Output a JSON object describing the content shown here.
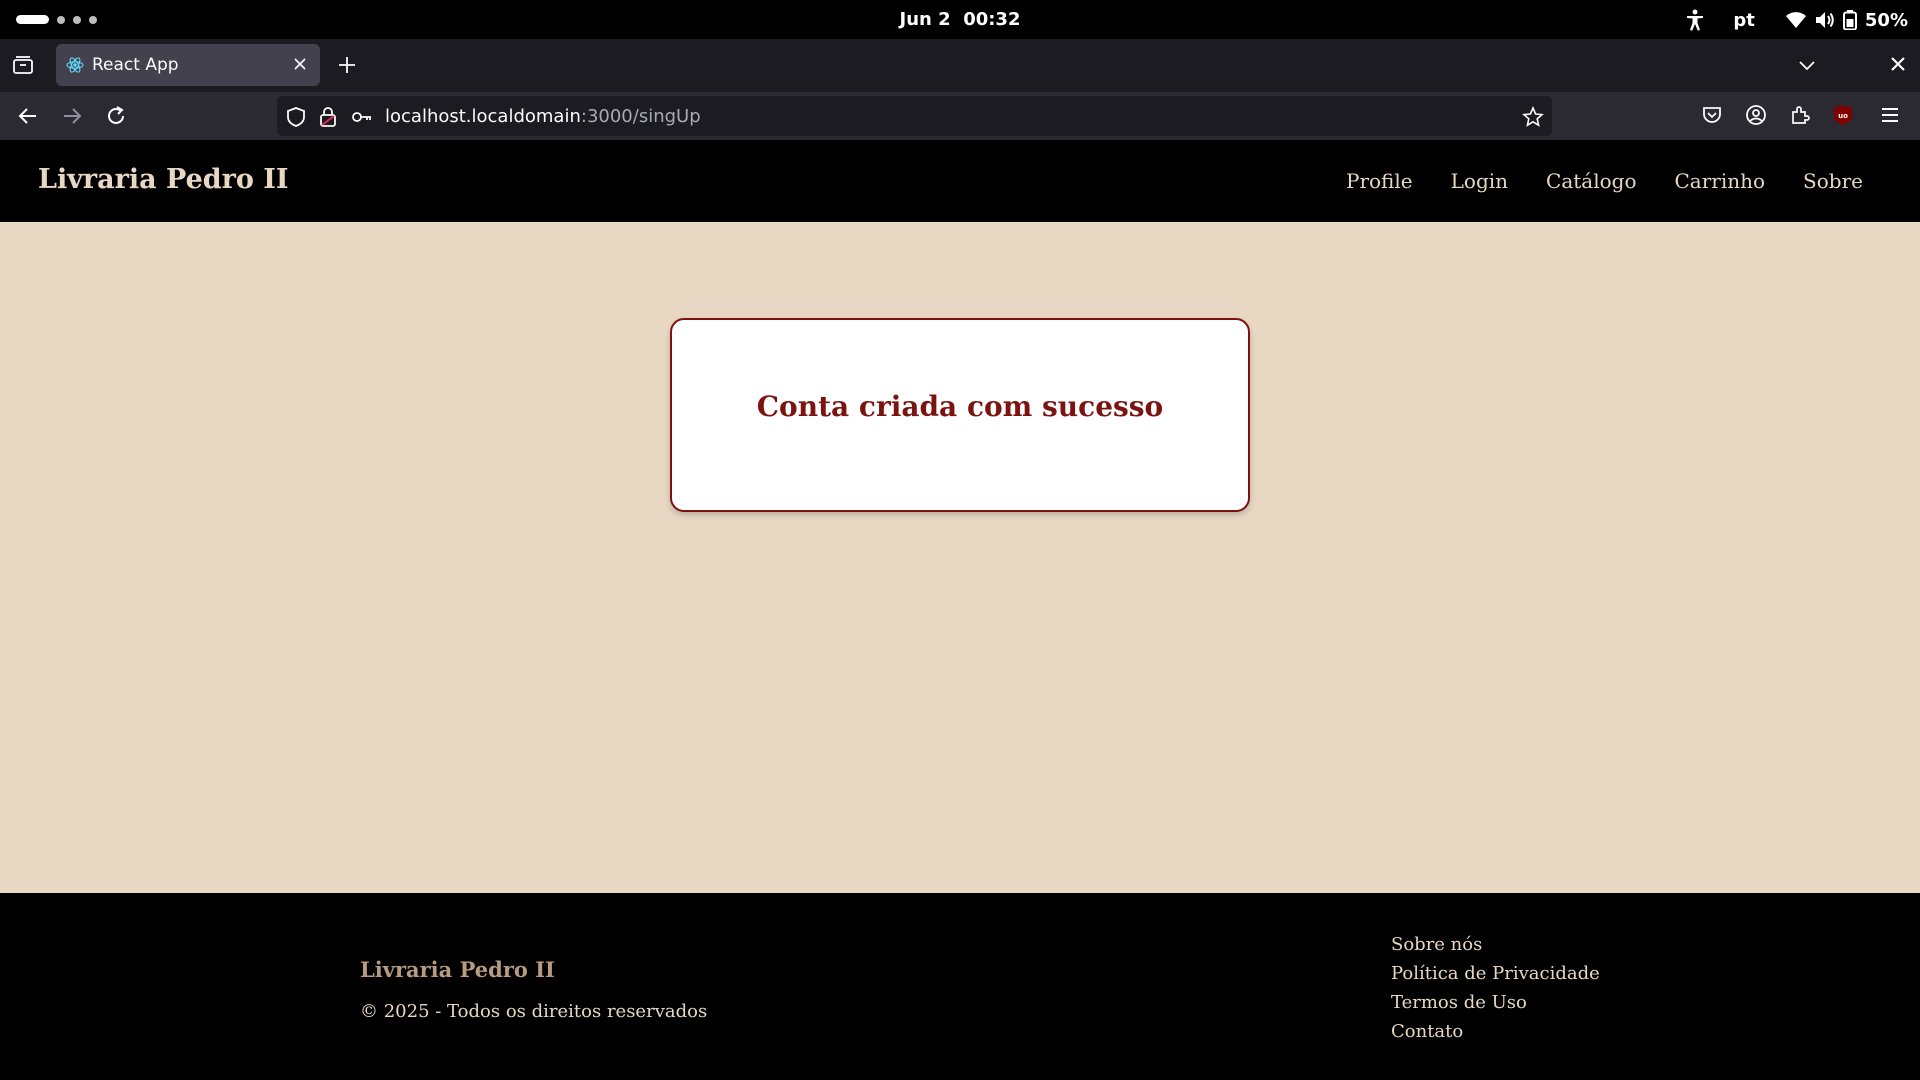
{
  "system": {
    "date": "Jun 2",
    "time": "00:32",
    "language": "pt",
    "battery": "50%"
  },
  "browser": {
    "tab_title": "React App",
    "url_host": "localhost.localdomain",
    "url_path": ":3000/singUp"
  },
  "site": {
    "brand": "Livraria Pedro II",
    "nav": [
      "Profile",
      "Login",
      "Catálogo",
      "Carrinho",
      "Sobre"
    ],
    "message": "Conta criada com sucesso",
    "footer": {
      "brand": "Livraria Pedro II",
      "copyright": "© 2025 - Todos os direitos reservados",
      "links": [
        "Sobre nós",
        "Política de Privacidade",
        "Termos de Uso",
        "Contato"
      ]
    }
  },
  "colors": {
    "page_bg": "#e7d7c3",
    "accent": "#7b1410",
    "header_bg": "#000000"
  },
  "icons": [
    "activities-indicator",
    "accessibility-icon",
    "wifi-icon",
    "volume-icon",
    "battery-icon",
    "tab-list-icon",
    "react-favicon",
    "close-icon",
    "plus-icon",
    "chevron-down-icon",
    "back-arrow-icon",
    "forward-arrow-icon",
    "reload-icon",
    "shield-icon",
    "lock-icon",
    "key-icon",
    "star-icon",
    "pocket-icon",
    "account-icon",
    "extensions-icon",
    "ublock-icon",
    "menu-icon"
  ]
}
